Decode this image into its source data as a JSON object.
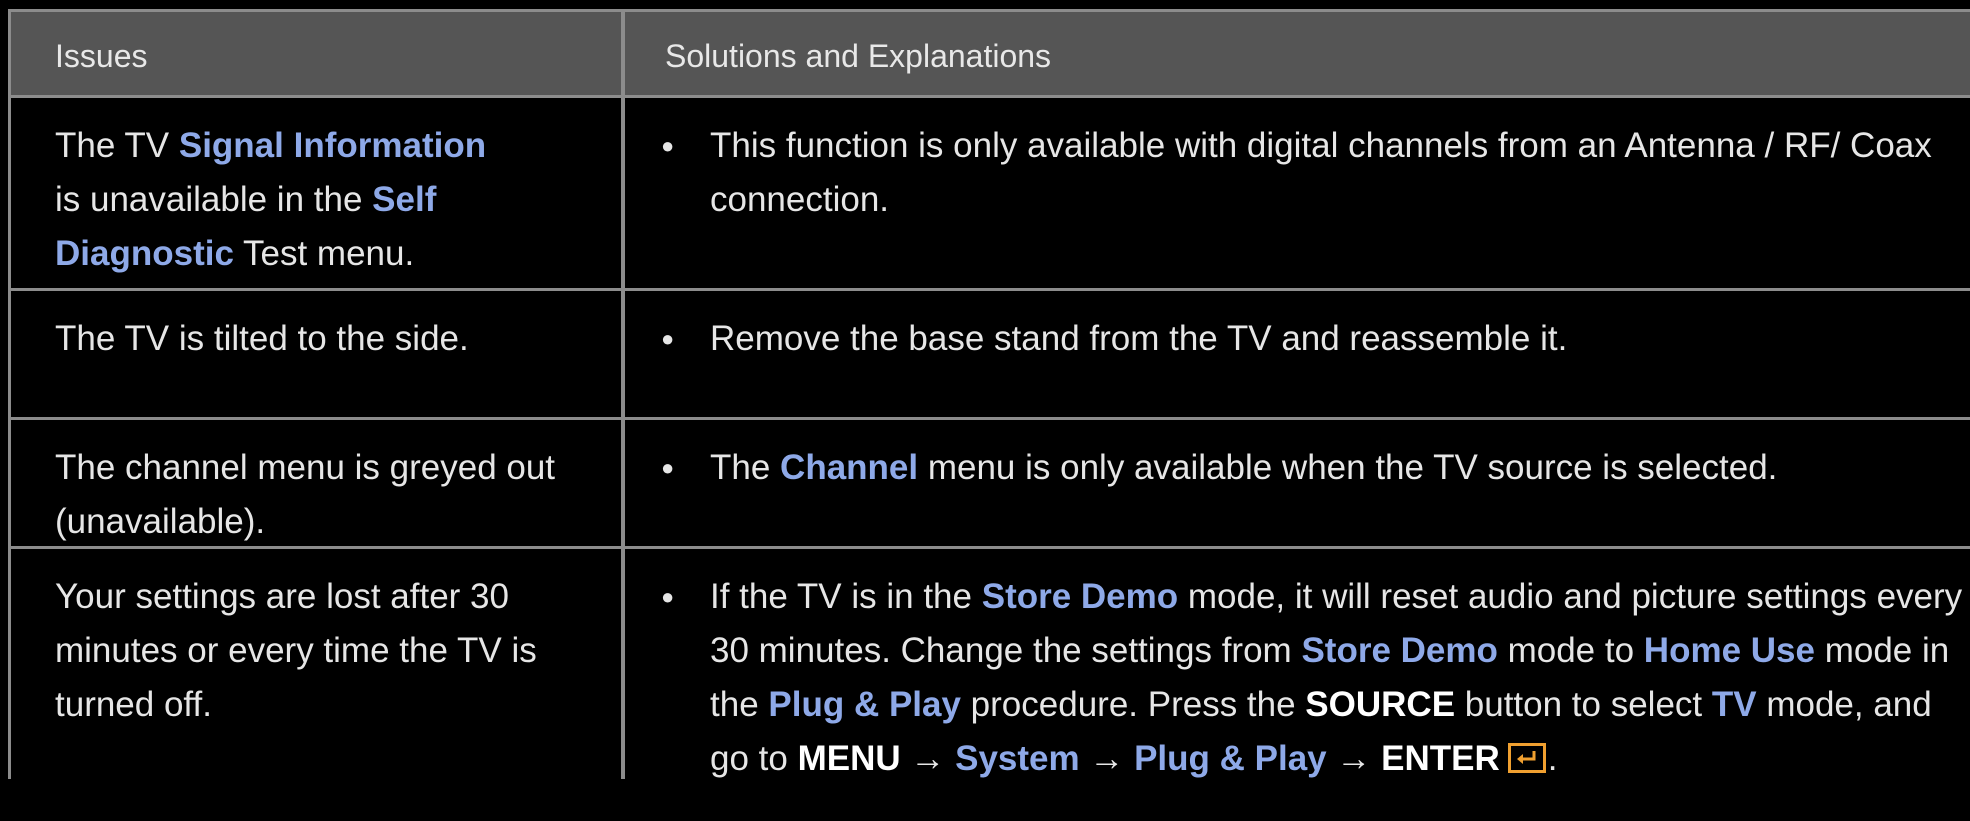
{
  "header": {
    "issues": "Issues",
    "solutions": "Solutions and Explanations"
  },
  "rows": [
    {
      "issue": [
        "The TV ",
        "Signal Information",
        " is unavailable in the ",
        "Self Diagnostic",
        " Test menu."
      ],
      "solution": [
        "This function is only available with digital channels from an Antenna / RF/ Coax connection."
      ]
    },
    {
      "issue": [
        "The TV is tilted to the side."
      ],
      "solution": [
        "Remove the base stand from the TV and reassemble it."
      ]
    },
    {
      "issue": [
        "The channel menu is greyed out (unavailable)."
      ],
      "solution": [
        "The ",
        "Channel",
        " menu is only available when the TV source is selected."
      ]
    },
    {
      "issue": [
        "Your settings are lost after 30 minutes or every time the TV is turned off."
      ],
      "solution": [
        "If the TV is in the ",
        "Store Demo",
        " mode, it will reset audio and picture settings every 30 minutes. Change the settings from ",
        "Store Demo",
        " mode to ",
        "Home Use",
        " mode in the ",
        "Plug & Play",
        " procedure. Press the ",
        "SOURCE",
        " button to select ",
        "TV",
        " mode, and go to ",
        "MENU",
        " → ",
        "System",
        " → ",
        "Plug & Play",
        " → ",
        "ENTER",
        "."
      ]
    }
  ],
  "icons": {
    "bullet": "bullet-dot",
    "enter": "enter-key-icon"
  },
  "colors": {
    "highlight": "#8ea9e8",
    "header_bg": "#555555",
    "border": "#8c8c8c",
    "background": "#000000",
    "enter_icon": "#f0a030"
  }
}
